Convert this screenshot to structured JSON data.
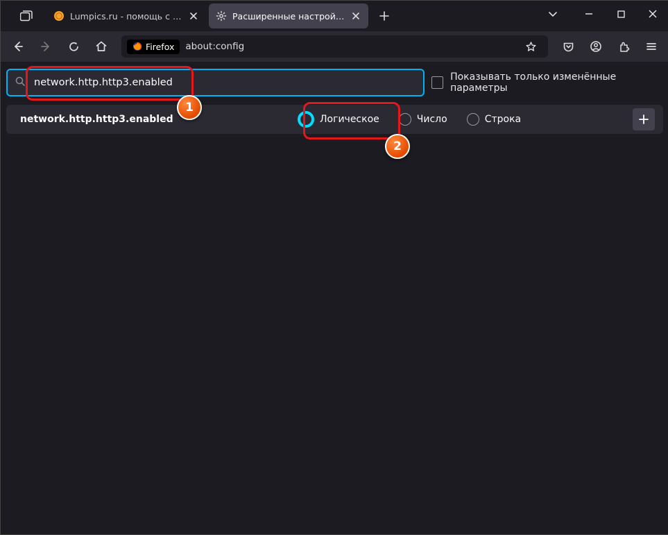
{
  "titlebar": {
    "tab1_title": "Lumpics.ru - помощь с компьютером",
    "tab2_title": "Расширенные настройки"
  },
  "toolbar": {
    "identity_label": "Firefox",
    "url_text": "about:config"
  },
  "content": {
    "search_value": "network.http.http3.enabled",
    "show_modified_label": "Показывать только изменённые параметры",
    "pref_name": "network.http.http3.enabled",
    "radio_bool": "Логическое",
    "radio_number": "Число",
    "radio_string": "Строка"
  },
  "annotations": {
    "step1": "1",
    "step2": "2"
  }
}
